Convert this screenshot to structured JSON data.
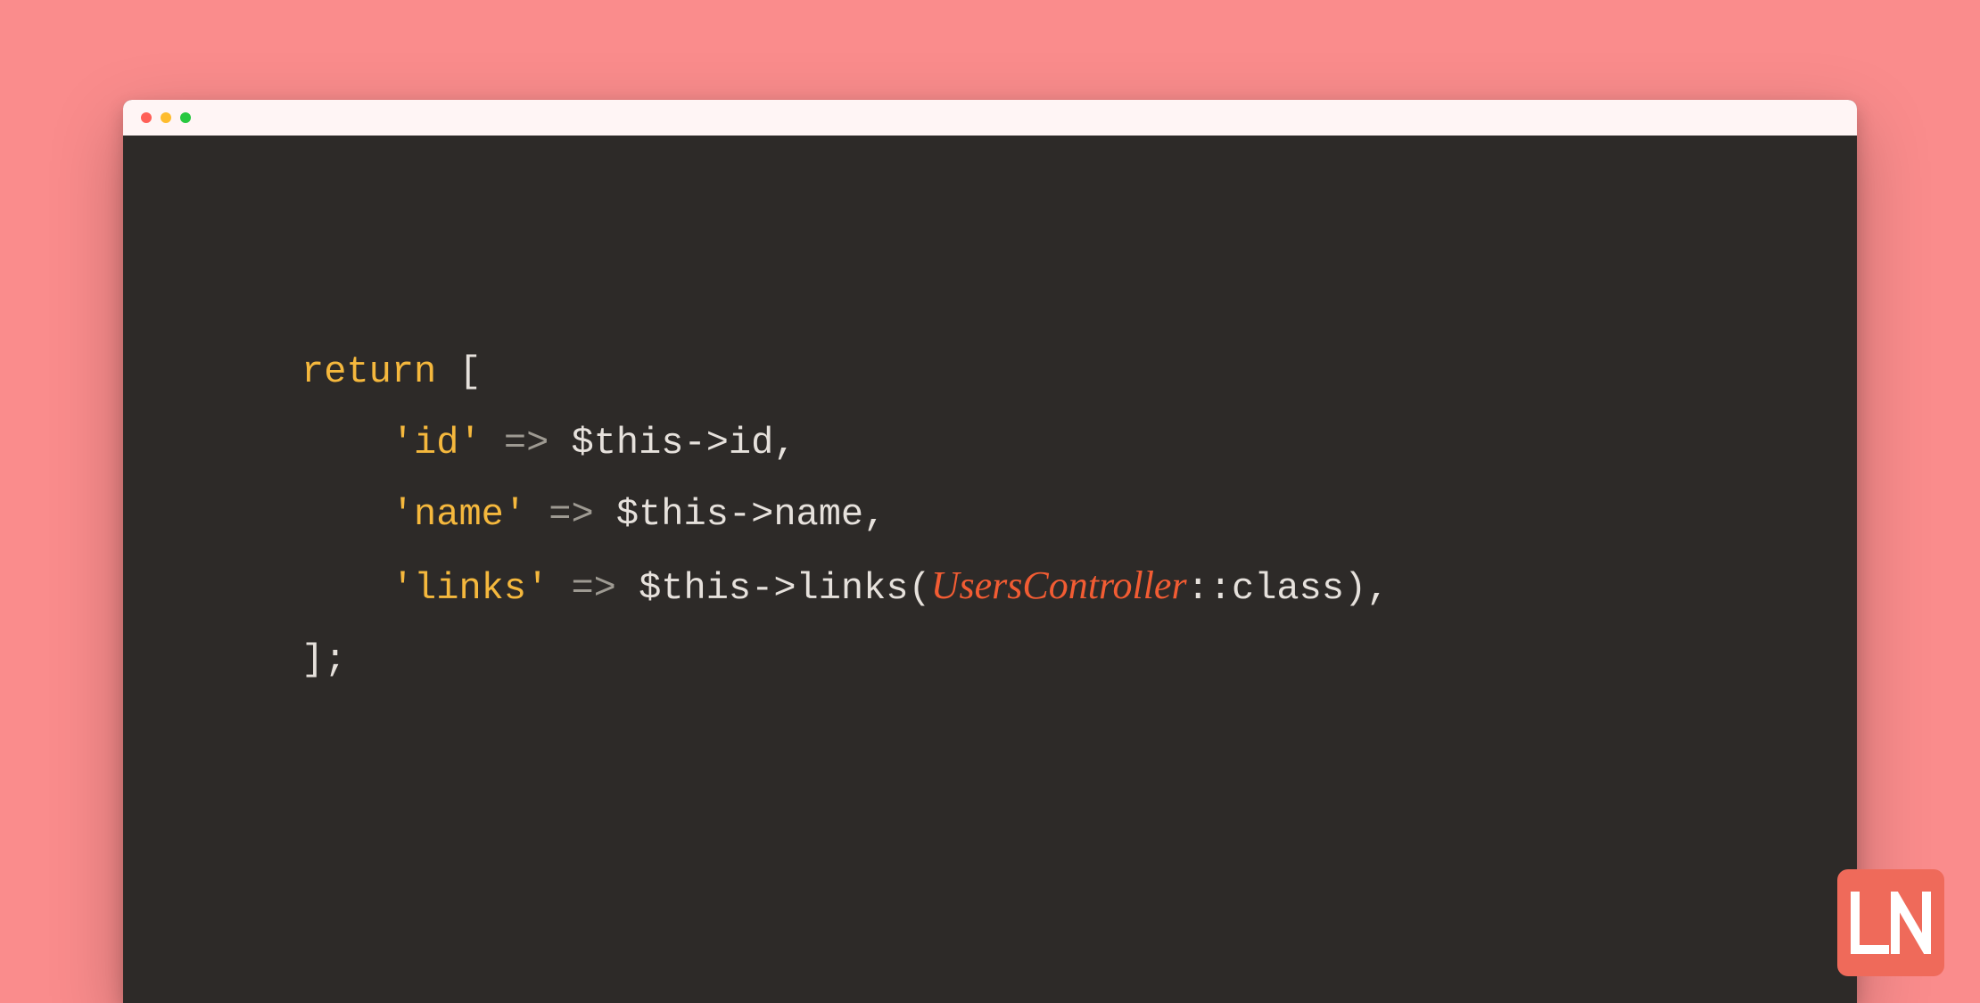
{
  "colors": {
    "page_bg": "#fa8c8c",
    "window_bg": "#2d2a28",
    "titlebar_bg": "#fff5f5",
    "traffic_red": "#ff5f57",
    "traffic_yellow": "#febc2e",
    "traffic_green": "#28c840",
    "code_default": "#e6e1dc",
    "code_keyword": "#f5b83d",
    "code_string": "#f5b83d",
    "code_class": "#f25c33",
    "badge_bg": "#ef6a5a"
  },
  "code": {
    "line1": {
      "keyword": "return",
      "after": " ["
    },
    "line2": {
      "indent": "    ",
      "key": "'id'",
      "arrow": " => ",
      "value": "$this->id,"
    },
    "line3": {
      "indent": "    ",
      "key": "'name'",
      "arrow": " => ",
      "value": "$this->name,"
    },
    "line4": {
      "indent": "    ",
      "key": "'links'",
      "arrow": " => ",
      "value_pre": "$this->links(",
      "class": "UsersController",
      "value_post": "::class),"
    },
    "line5": {
      "text": "];"
    }
  },
  "badge": {
    "letters": "LN"
  }
}
